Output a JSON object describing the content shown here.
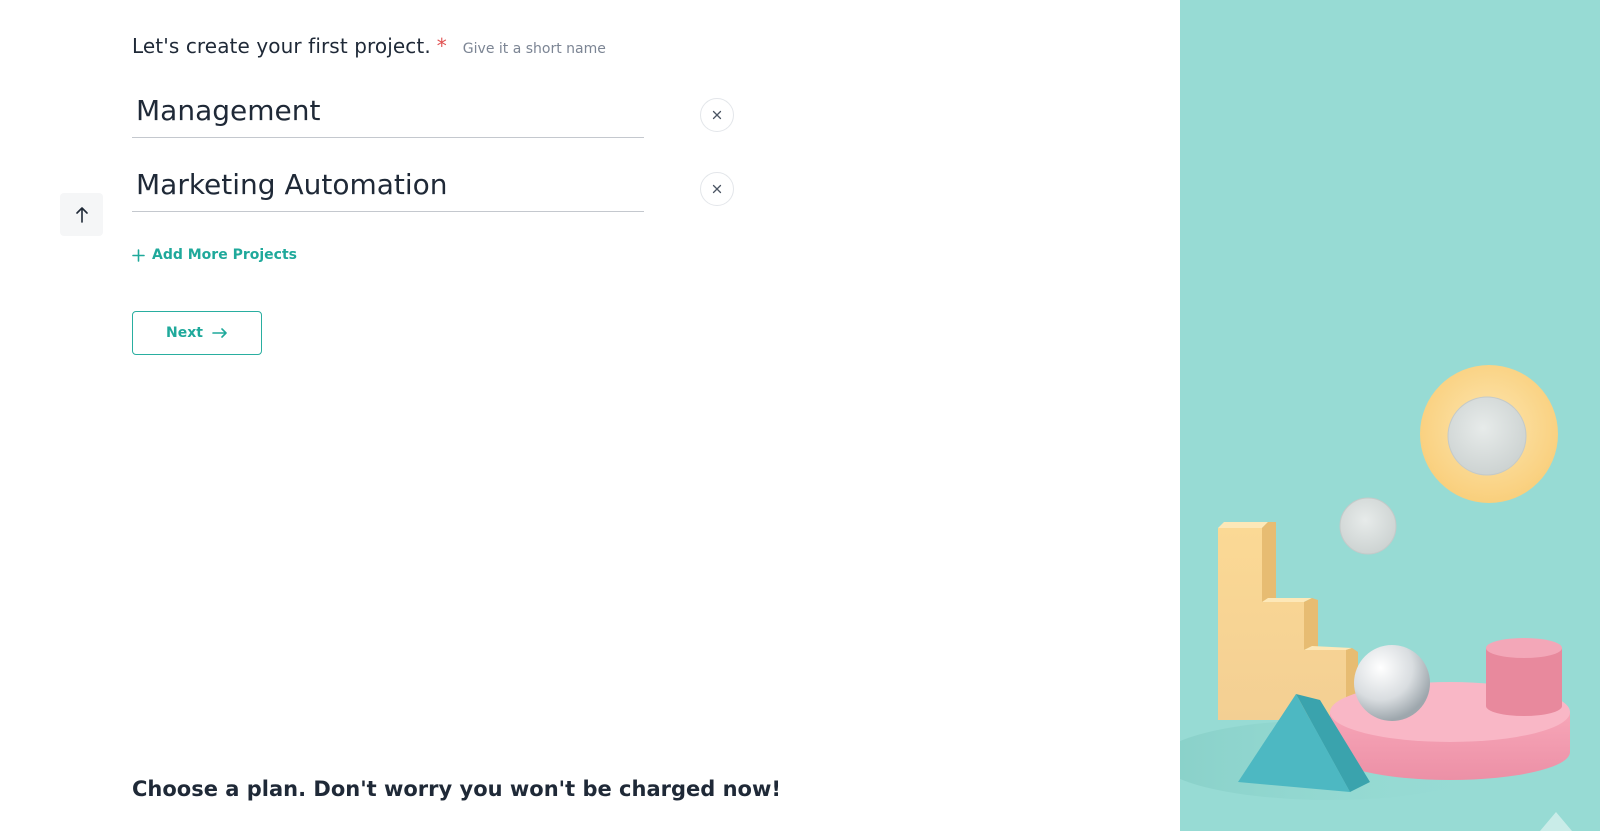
{
  "question": {
    "text": "Let's create your first project.",
    "required_marker": "*",
    "hint": "Give it a short name"
  },
  "projects": [
    {
      "value": "Management",
      "remove_icon": "close-icon"
    },
    {
      "value": "Marketing Automation",
      "remove_icon": "close-icon"
    }
  ],
  "add_more_label": "Add More Projects",
  "next_label": "Next",
  "plan_heading": "Choose a plan. Don't worry you won't be charged now!",
  "icons": {
    "scroll_up": "arrow-up-icon",
    "add": "plus-icon",
    "next": "arrow-right-icon"
  },
  "colors": {
    "accent": "#1fa99b",
    "required": "#e05252",
    "panel_bg": "#97dbd4"
  }
}
